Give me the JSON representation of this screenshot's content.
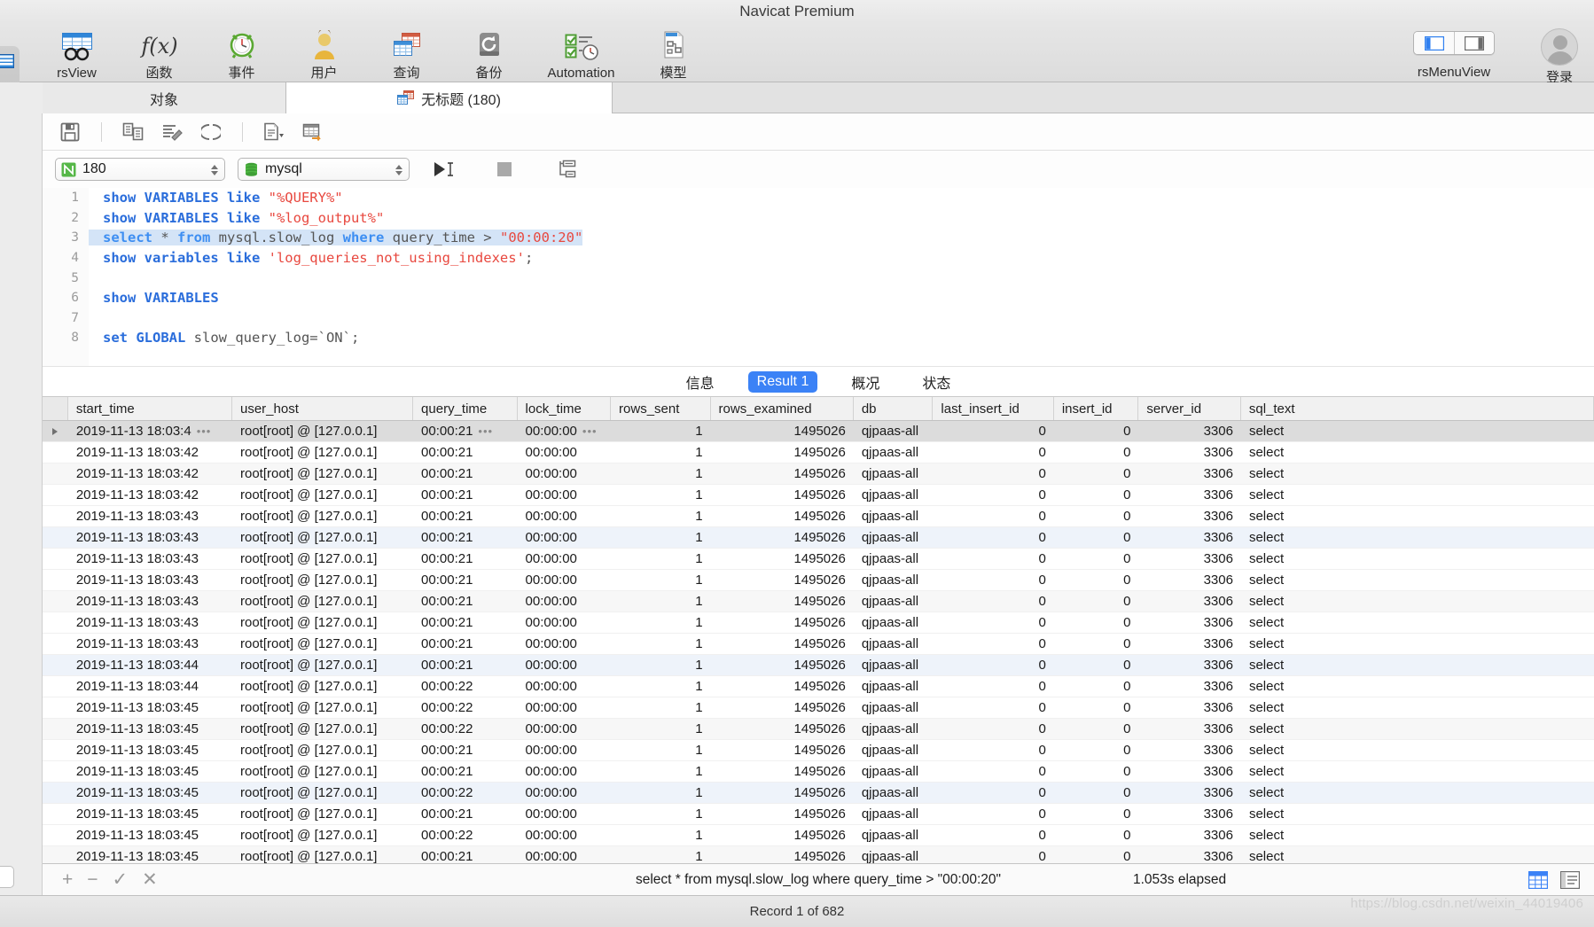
{
  "window": {
    "title": "Navicat Premium"
  },
  "toolbar": {
    "items": [
      {
        "label": "rsView",
        "icon": "table-view-icon"
      },
      {
        "label": "函数",
        "icon": "function-fx-icon"
      },
      {
        "label": "事件",
        "icon": "clock-event-icon"
      },
      {
        "label": "用户",
        "icon": "user-icon"
      },
      {
        "label": "查询",
        "icon": "query-tables-icon"
      },
      {
        "label": "备份",
        "icon": "backup-restore-icon"
      },
      {
        "label": "Automation",
        "icon": "automation-checklist-icon"
      },
      {
        "label": "模型",
        "icon": "model-diagram-icon"
      }
    ],
    "right": {
      "view_toggle_label": "rsMenuView",
      "left_panel_icon": "layout-left-panel-icon",
      "right_panel_icon": "layout-right-panel-icon",
      "account_label": "登录",
      "avatar_icon": "avatar-icon"
    }
  },
  "tabs": [
    {
      "label": "对象",
      "active": false,
      "icon": ""
    },
    {
      "label": "无标题 (180)",
      "active": true,
      "icon": "query-tab-icon"
    }
  ],
  "editor_toolbar": {
    "buttons": [
      {
        "name": "save-icon",
        "label": "保存"
      },
      {
        "name": "beautify-sql-icon",
        "label": "美化 SQL"
      },
      {
        "name": "edit-in-sql-icon",
        "label": "编辑"
      },
      {
        "name": "parentheses-icon",
        "label": "()"
      },
      {
        "name": "explain-icon",
        "label": "解释"
      },
      {
        "name": "export-result-icon",
        "label": "导出结果"
      }
    ]
  },
  "query_row": {
    "connection": {
      "value": "180",
      "icon": "navicat-connection-icon"
    },
    "database": {
      "value": "mysql",
      "icon": "database-icon"
    },
    "run_icon": "run-play-icon",
    "stop_icon": "stop-square-icon",
    "explain_icon": "explain-plan-icon"
  },
  "sql_lines": [
    {
      "n": "1",
      "segments": [
        {
          "t": "show VARIABLES like ",
          "c": "kw"
        },
        {
          "t": "\"%QUERY%\"",
          "c": "str"
        }
      ]
    },
    {
      "n": "2",
      "segments": [
        {
          "t": "show VARIABLES like ",
          "c": "kw"
        },
        {
          "t": "\"%log_output%\"",
          "c": "str"
        }
      ]
    },
    {
      "n": "3",
      "highlight": true,
      "segments": [
        {
          "t": "select ",
          "c": "kw2"
        },
        {
          "t": "* ",
          "c": "plain"
        },
        {
          "t": "from ",
          "c": "kw2"
        },
        {
          "t": "mysql.slow_log ",
          "c": "plain"
        },
        {
          "t": "where ",
          "c": "kw2"
        },
        {
          "t": "query_time > ",
          "c": "plain"
        },
        {
          "t": "\"00:00:20\"",
          "c": "str"
        }
      ]
    },
    {
      "n": "4",
      "segments": [
        {
          "t": "show variables like ",
          "c": "kw"
        },
        {
          "t": "'log_queries_not_using_indexes'",
          "c": "str"
        },
        {
          "t": ";",
          "c": "plain"
        }
      ]
    },
    {
      "n": "5",
      "segments": []
    },
    {
      "n": "6",
      "segments": [
        {
          "t": "show VARIABLES",
          "c": "kw"
        }
      ]
    },
    {
      "n": "7",
      "segments": []
    },
    {
      "n": "8",
      "segments": [
        {
          "t": "set GLOBAL ",
          "c": "kw"
        },
        {
          "t": "slow_query_log=`ON`;",
          "c": "plain"
        }
      ]
    }
  ],
  "result_tabs": [
    {
      "label": "信息",
      "selected": false
    },
    {
      "label": "Result 1",
      "selected": true
    },
    {
      "label": "概况",
      "selected": false
    },
    {
      "label": "状态",
      "selected": false
    }
  ],
  "grid": {
    "columns": [
      {
        "key": "start_time",
        "label": "start_time",
        "w": "w-start",
        "num": false
      },
      {
        "key": "user_host",
        "label": "user_host",
        "w": "w-user",
        "num": false
      },
      {
        "key": "query_time",
        "label": "query_time",
        "w": "w-query",
        "num": false
      },
      {
        "key": "lock_time",
        "label": "lock_time",
        "w": "w-lock",
        "num": false
      },
      {
        "key": "rows_sent",
        "label": "rows_sent",
        "w": "w-rsent",
        "num": true
      },
      {
        "key": "rows_examined",
        "label": "rows_examined",
        "w": "w-rexam",
        "num": true
      },
      {
        "key": "db",
        "label": "db",
        "w": "w-db",
        "num": false
      },
      {
        "key": "last_insert_id",
        "label": "last_insert_id",
        "w": "w-lii",
        "num": true
      },
      {
        "key": "insert_id",
        "label": "insert_id",
        "w": "w-ii",
        "num": true
      },
      {
        "key": "server_id",
        "label": "server_id",
        "w": "w-srv",
        "num": true
      },
      {
        "key": "sql_text",
        "label": "sql_text",
        "w": "w-sql",
        "num": false
      }
    ],
    "rows": [
      {
        "selected": true,
        "start_time": "2019-11-13 18:03:4",
        "user_host": "root[root] @  [127.0.0.1]",
        "query_time": "00:00:21",
        "lock_time": "00:00:00",
        "rows_sent": "1",
        "rows_examined": "1495026",
        "db": "qjpaas-all",
        "last_insert_id": "0",
        "insert_id": "0",
        "server_id": "3306",
        "sql_text": "select"
      },
      {
        "start_time": "2019-11-13 18:03:42",
        "user_host": "root[root] @  [127.0.0.1]",
        "query_time": "00:00:21",
        "lock_time": "00:00:00",
        "rows_sent": "1",
        "rows_examined": "1495026",
        "db": "qjpaas-all",
        "last_insert_id": "0",
        "insert_id": "0",
        "server_id": "3306",
        "sql_text": "select"
      },
      {
        "start_time": "2019-11-13 18:03:42",
        "user_host": "root[root] @  [127.0.0.1]",
        "query_time": "00:00:21",
        "lock_time": "00:00:00",
        "rows_sent": "1",
        "rows_examined": "1495026",
        "db": "qjpaas-all",
        "last_insert_id": "0",
        "insert_id": "0",
        "server_id": "3306",
        "sql_text": "select"
      },
      {
        "start_time": "2019-11-13 18:03:42",
        "user_host": "root[root] @  [127.0.0.1]",
        "query_time": "00:00:21",
        "lock_time": "00:00:00",
        "rows_sent": "1",
        "rows_examined": "1495026",
        "db": "qjpaas-all",
        "last_insert_id": "0",
        "insert_id": "0",
        "server_id": "3306",
        "sql_text": "select"
      },
      {
        "start_time": "2019-11-13 18:03:43",
        "user_host": "root[root] @  [127.0.0.1]",
        "query_time": "00:00:21",
        "lock_time": "00:00:00",
        "rows_sent": "1",
        "rows_examined": "1495026",
        "db": "qjpaas-all",
        "last_insert_id": "0",
        "insert_id": "0",
        "server_id": "3306",
        "sql_text": "select"
      },
      {
        "start_time": "2019-11-13 18:03:43",
        "user_host": "root[root] @  [127.0.0.1]",
        "query_time": "00:00:21",
        "lock_time": "00:00:00",
        "rows_sent": "1",
        "rows_examined": "1495026",
        "db": "qjpaas-all",
        "last_insert_id": "0",
        "insert_id": "0",
        "server_id": "3306",
        "sql_text": "select"
      },
      {
        "start_time": "2019-11-13 18:03:43",
        "user_host": "root[root] @  [127.0.0.1]",
        "query_time": "00:00:21",
        "lock_time": "00:00:00",
        "rows_sent": "1",
        "rows_examined": "1495026",
        "db": "qjpaas-all",
        "last_insert_id": "0",
        "insert_id": "0",
        "server_id": "3306",
        "sql_text": "select"
      },
      {
        "start_time": "2019-11-13 18:03:43",
        "user_host": "root[root] @  [127.0.0.1]",
        "query_time": "00:00:21",
        "lock_time": "00:00:00",
        "rows_sent": "1",
        "rows_examined": "1495026",
        "db": "qjpaas-all",
        "last_insert_id": "0",
        "insert_id": "0",
        "server_id": "3306",
        "sql_text": "select"
      },
      {
        "start_time": "2019-11-13 18:03:43",
        "user_host": "root[root] @  [127.0.0.1]",
        "query_time": "00:00:21",
        "lock_time": "00:00:00",
        "rows_sent": "1",
        "rows_examined": "1495026",
        "db": "qjpaas-all",
        "last_insert_id": "0",
        "insert_id": "0",
        "server_id": "3306",
        "sql_text": "select"
      },
      {
        "start_time": "2019-11-13 18:03:43",
        "user_host": "root[root] @  [127.0.0.1]",
        "query_time": "00:00:21",
        "lock_time": "00:00:00",
        "rows_sent": "1",
        "rows_examined": "1495026",
        "db": "qjpaas-all",
        "last_insert_id": "0",
        "insert_id": "0",
        "server_id": "3306",
        "sql_text": "select"
      },
      {
        "start_time": "2019-11-13 18:03:43",
        "user_host": "root[root] @  [127.0.0.1]",
        "query_time": "00:00:21",
        "lock_time": "00:00:00",
        "rows_sent": "1",
        "rows_examined": "1495026",
        "db": "qjpaas-all",
        "last_insert_id": "0",
        "insert_id": "0",
        "server_id": "3306",
        "sql_text": "select"
      },
      {
        "start_time": "2019-11-13 18:03:44",
        "user_host": "root[root] @  [127.0.0.1]",
        "query_time": "00:00:21",
        "lock_time": "00:00:00",
        "rows_sent": "1",
        "rows_examined": "1495026",
        "db": "qjpaas-all",
        "last_insert_id": "0",
        "insert_id": "0",
        "server_id": "3306",
        "sql_text": "select"
      },
      {
        "start_time": "2019-11-13 18:03:44",
        "user_host": "root[root] @  [127.0.0.1]",
        "query_time": "00:00:22",
        "lock_time": "00:00:00",
        "rows_sent": "1",
        "rows_examined": "1495026",
        "db": "qjpaas-all",
        "last_insert_id": "0",
        "insert_id": "0",
        "server_id": "3306",
        "sql_text": "select"
      },
      {
        "start_time": "2019-11-13 18:03:45",
        "user_host": "root[root] @  [127.0.0.1]",
        "query_time": "00:00:22",
        "lock_time": "00:00:00",
        "rows_sent": "1",
        "rows_examined": "1495026",
        "db": "qjpaas-all",
        "last_insert_id": "0",
        "insert_id": "0",
        "server_id": "3306",
        "sql_text": "select"
      },
      {
        "start_time": "2019-11-13 18:03:45",
        "user_host": "root[root] @  [127.0.0.1]",
        "query_time": "00:00:22",
        "lock_time": "00:00:00",
        "rows_sent": "1",
        "rows_examined": "1495026",
        "db": "qjpaas-all",
        "last_insert_id": "0",
        "insert_id": "0",
        "server_id": "3306",
        "sql_text": "select"
      },
      {
        "start_time": "2019-11-13 18:03:45",
        "user_host": "root[root] @  [127.0.0.1]",
        "query_time": "00:00:21",
        "lock_time": "00:00:00",
        "rows_sent": "1",
        "rows_examined": "1495026",
        "db": "qjpaas-all",
        "last_insert_id": "0",
        "insert_id": "0",
        "server_id": "3306",
        "sql_text": "select"
      },
      {
        "start_time": "2019-11-13 18:03:45",
        "user_host": "root[root] @  [127.0.0.1]",
        "query_time": "00:00:21",
        "lock_time": "00:00:00",
        "rows_sent": "1",
        "rows_examined": "1495026",
        "db": "qjpaas-all",
        "last_insert_id": "0",
        "insert_id": "0",
        "server_id": "3306",
        "sql_text": "select"
      },
      {
        "start_time": "2019-11-13 18:03:45",
        "user_host": "root[root] @  [127.0.0.1]",
        "query_time": "00:00:22",
        "lock_time": "00:00:00",
        "rows_sent": "1",
        "rows_examined": "1495026",
        "db": "qjpaas-all",
        "last_insert_id": "0",
        "insert_id": "0",
        "server_id": "3306",
        "sql_text": "select"
      },
      {
        "start_time": "2019-11-13 18:03:45",
        "user_host": "root[root] @  [127.0.0.1]",
        "query_time": "00:00:21",
        "lock_time": "00:00:00",
        "rows_sent": "1",
        "rows_examined": "1495026",
        "db": "qjpaas-all",
        "last_insert_id": "0",
        "insert_id": "0",
        "server_id": "3306",
        "sql_text": "select"
      },
      {
        "start_time": "2019-11-13 18:03:45",
        "user_host": "root[root] @  [127.0.0.1]",
        "query_time": "00:00:22",
        "lock_time": "00:00:00",
        "rows_sent": "1",
        "rows_examined": "1495026",
        "db": "qjpaas-all",
        "last_insert_id": "0",
        "insert_id": "0",
        "server_id": "3306",
        "sql_text": "select"
      },
      {
        "start_time": "2019-11-13 18:03:45",
        "user_host": "root[root] @  [127.0.0.1]",
        "query_time": "00:00:21",
        "lock_time": "00:00:00",
        "rows_sent": "1",
        "rows_examined": "1495026",
        "db": "qjpaas-all",
        "last_insert_id": "0",
        "insert_id": "0",
        "server_id": "3306",
        "sql_text": "select"
      }
    ]
  },
  "edit_bar": {
    "add_label": "+",
    "remove_label": "−",
    "confirm_label": "✓",
    "cancel_label": "✕",
    "sql": "select * from mysql.slow_log where query_time > \"00:00:20\"",
    "elapsed": "1.053s elapsed",
    "grid_view_icon": "grid-view-icon",
    "form_view_icon": "form-view-icon"
  },
  "status_bar": {
    "record": "Record 1 of 682"
  },
  "watermark": {
    "text": "https://blog.csdn.net/weixin_44019406"
  },
  "colors": {
    "accent_blue": "#3b82f6",
    "sql_keyword": "#2a6ddb",
    "sql_string": "#e8483f",
    "selection": "#d4e4f7",
    "row_selected": "#dcdcdc"
  }
}
